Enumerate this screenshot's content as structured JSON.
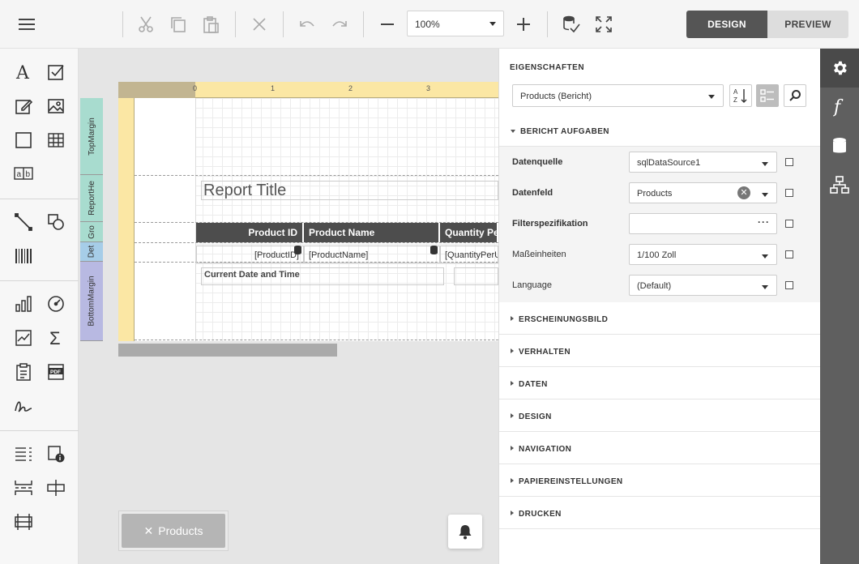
{
  "toolbar": {
    "zoom_value": "100%",
    "mode_design": "DESIGN",
    "mode_preview": "PREVIEW",
    "icons": [
      "menu-icon",
      "cut-icon",
      "copy-icon",
      "paste-icon",
      "delete-icon",
      "undo-icon",
      "redo-icon",
      "zoom-out-icon",
      "zoom-in-icon",
      "validate-icon",
      "fullscreen-icon"
    ]
  },
  "canvas": {
    "ruler_numbers": [
      "0",
      "1",
      "2",
      "3"
    ],
    "bands": [
      "TopMargin",
      "ReportHe",
      "Gro",
      "Det",
      "BottomMargin"
    ],
    "report_title": "Report Title",
    "headers": [
      "Product ID",
      "Product Name",
      "Quantity Per"
    ],
    "cells": [
      "[ProductID]",
      "[ProductName]",
      "[QuantityPerU"
    ],
    "date_label": "Current Date and Time",
    "tab_label": "Products",
    "tab_close": "✕"
  },
  "properties": {
    "title": "EIGENSCHAFTEN",
    "selected_object": "Products (Bericht)",
    "expanded_section": "BERICHT AUFGABEN",
    "rows": [
      {
        "label": "Datenquelle",
        "value": "sqlDataSource1"
      },
      {
        "label": "Datenfeld",
        "value": "Products"
      },
      {
        "label": "Filterspezifikation",
        "value": "",
        "dots": "···"
      },
      {
        "label": "Maßeinheiten",
        "value": "1/100 Zoll"
      },
      {
        "label": "Language",
        "value": "(Default)"
      }
    ],
    "sections": [
      "ERSCHEINUNGSBILD",
      "VERHALTEN",
      "DATEN",
      "DESIGN",
      "NAVIGATION",
      "PAPIEREINSTELLUNGEN",
      "DRUCKEN"
    ]
  },
  "rail": {
    "items": [
      "gear-icon",
      "function-icon",
      "database-icon",
      "hierarchy-icon"
    ]
  }
}
